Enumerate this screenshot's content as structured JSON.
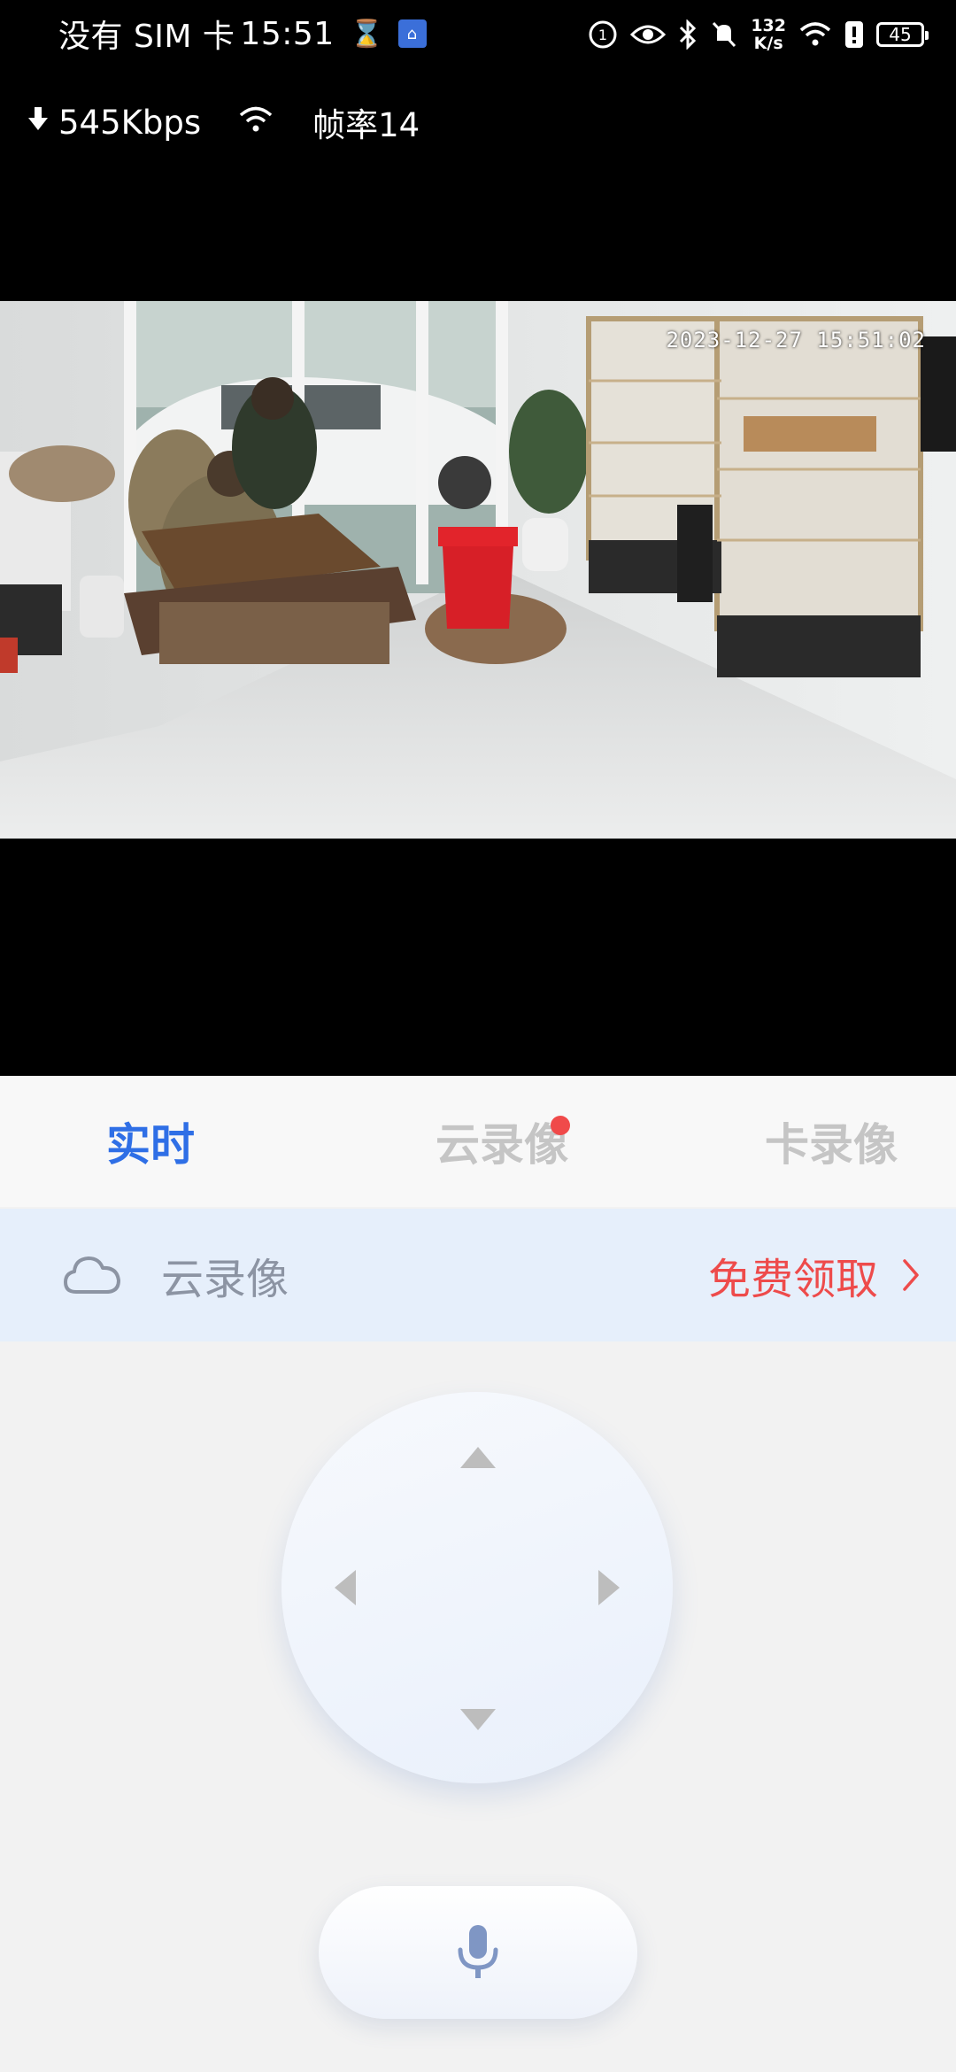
{
  "status_bar": {
    "carrier": "没有 SIM 卡",
    "time": "15:51",
    "net_speed_value": "132",
    "net_speed_unit": "K/s",
    "battery": "45"
  },
  "stream": {
    "bitrate": "545Kbps",
    "framerate": "帧率14"
  },
  "video": {
    "timestamp": "2023-12-27 15:51:02"
  },
  "tabs": [
    {
      "label": "实时",
      "active": true
    },
    {
      "label": "云录像",
      "active": false,
      "badge": true
    },
    {
      "label": "卡录像",
      "active": false
    }
  ],
  "cloud_banner": {
    "label": "云录像",
    "cta": "免费领取"
  },
  "colors": {
    "accent": "#2f6fe6",
    "cta_red": "#ee4b4b",
    "banner_bg": "#e6effb"
  },
  "icons": {
    "ptz": [
      "arrow-up-icon",
      "arrow-down-icon",
      "arrow-left-icon",
      "arrow-right-icon"
    ],
    "mic": "microphone-icon",
    "cloud": "cloud-icon"
  }
}
